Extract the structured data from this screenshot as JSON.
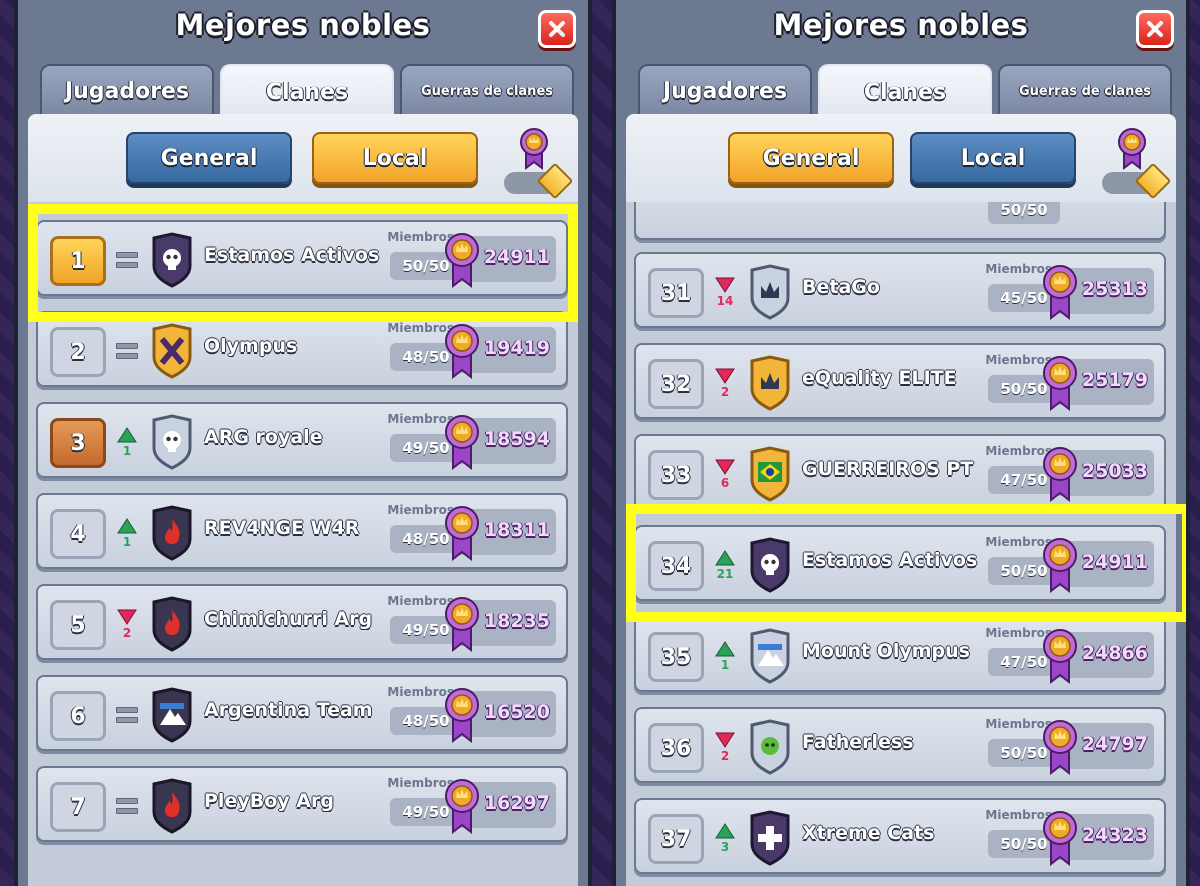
{
  "panels": [
    {
      "title": "Mejores nobles",
      "tabs": [
        "Jugadores",
        "Clanes",
        "Guerras de clanes"
      ],
      "active_tab": "Clanes",
      "filters": {
        "general": "General",
        "local": "Local",
        "active": "Local"
      },
      "members_label": "Miembros",
      "rows": [
        {
          "rank": "1",
          "change": "=",
          "change_num": "",
          "badge": "skull-badge-purple",
          "name": "Estamos Activos",
          "members": "50/50",
          "score": "24911",
          "highlight": true
        },
        {
          "rank": "2",
          "change": "=",
          "change_num": "",
          "badge": "x-badge-gold",
          "name": "Olympus",
          "members": "48/50",
          "score": "19419"
        },
        {
          "rank": "3",
          "change": "up",
          "change_num": "1",
          "badge": "skull-badge-silver",
          "name": "ARG royale",
          "members": "49/50",
          "score": "18594"
        },
        {
          "rank": "4",
          "change": "up",
          "change_num": "1",
          "badge": "fire-badge-dark",
          "name": "REV4NGE W4R",
          "members": "48/50",
          "score": "18311"
        },
        {
          "rank": "5",
          "change": "down",
          "change_num": "2",
          "badge": "fire-badge-dark",
          "name": "Chimichurri Arg",
          "members": "49/50",
          "score": "18235"
        },
        {
          "rank": "6",
          "change": "=",
          "change_num": "",
          "badge": "mountain-badge-dark",
          "name": "Argentina Team",
          "members": "48/50",
          "score": "16520"
        },
        {
          "rank": "7",
          "change": "=",
          "change_num": "",
          "badge": "fire-badge-dark",
          "name": "PleyBoy Arg",
          "members": "49/50",
          "score": "16297"
        }
      ]
    },
    {
      "title": "Mejores nobles",
      "tabs": [
        "Jugadores",
        "Clanes",
        "Guerras de clanes"
      ],
      "active_tab": "Clanes",
      "filters": {
        "general": "General",
        "local": "Local",
        "active": "General"
      },
      "members_label": "Miembros",
      "partial_row": {
        "members": "50/50"
      },
      "rows": [
        {
          "rank": "31",
          "change": "down",
          "change_num": "14",
          "badge": "crown-badge-silver",
          "name": "BetaGo",
          "members": "45/50",
          "score": "25313"
        },
        {
          "rank": "32",
          "change": "down",
          "change_num": "2",
          "badge": "crown-badge-gold",
          "name": "eQuality ELITE",
          "members": "50/50",
          "score": "25179"
        },
        {
          "rank": "33",
          "change": "down",
          "change_num": "6",
          "badge": "brazil-badge",
          "name": "GUERREIROS PT",
          "members": "47/50",
          "score": "25033"
        },
        {
          "rank": "34",
          "change": "up",
          "change_num": "21",
          "badge": "skull-badge-purple",
          "name": "Estamos Activos",
          "members": "50/50",
          "score": "24911",
          "highlight": true
        },
        {
          "rank": "35",
          "change": "up",
          "change_num": "1",
          "badge": "mountain-badge-silver",
          "name": "Mount Olympus",
          "members": "47/50",
          "score": "24866"
        },
        {
          "rank": "36",
          "change": "down",
          "change_num": "2",
          "badge": "goblin-badge-silver",
          "name": "Fatherless",
          "members": "50/50",
          "score": "24797"
        },
        {
          "rank": "37",
          "change": "up",
          "change_num": "3",
          "badge": "cross-badge-purple",
          "name": "Xtreme Cats",
          "members": "50/50",
          "score": "24323"
        }
      ]
    }
  ],
  "colors": {
    "highlight": "#ffff1a",
    "up": "#2aa35a",
    "down": "#e0285a",
    "score_text": "#f4d9ff"
  }
}
